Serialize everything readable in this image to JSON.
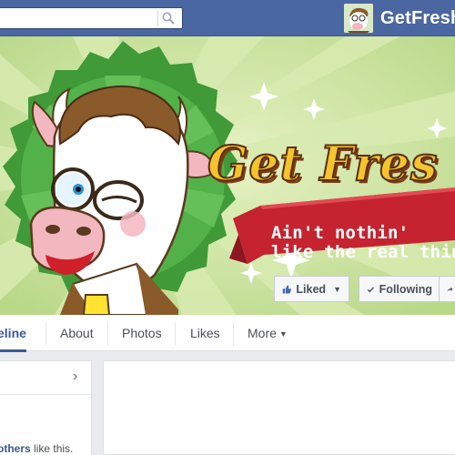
{
  "topbar": {
    "search": {
      "placeholder": ""
    },
    "profile": {
      "name": "GetFresh",
      "avatar_icon": "cow-avatar-icon"
    }
  },
  "cover": {
    "title": "Get Fres",
    "slogan": [
      "Ain't nothin'",
      "like the real thin"
    ],
    "colors": {
      "green_background": "#c7e09a",
      "badge_green": "#3f9a37",
      "ribbon_red": "#c4232f",
      "title_yellow": "#f5c42c"
    }
  },
  "actions": {
    "liked_label": "Liked",
    "following_label": "Following"
  },
  "tabs": [
    {
      "label": "eline"
    },
    {
      "label": "About"
    },
    {
      "label": "Photos"
    },
    {
      "label": "Likes"
    },
    {
      "label": "More"
    }
  ],
  "sidebar": {
    "likes_link": "others",
    "likes_suffix": " like this."
  }
}
